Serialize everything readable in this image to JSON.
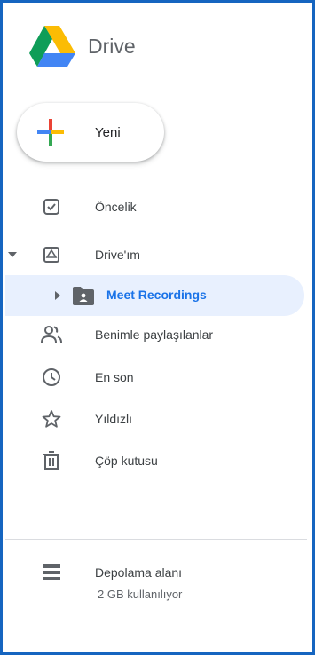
{
  "app": {
    "title": "Drive"
  },
  "new_button": {
    "label": "Yeni"
  },
  "nav": {
    "priority": "Öncelik",
    "my_drive": "Drive'ım",
    "meet_recordings": "Meet Recordings",
    "shared": "Benimle paylaşılanlar",
    "recent": "En son",
    "starred": "Yıldızlı",
    "trash": "Çöp kutusu",
    "storage": "Depolama alanı"
  },
  "storage": {
    "used": "2 GB kullanılıyor"
  },
  "colors": {
    "accent_blue": "#1a73e8",
    "selected_bg": "#e8f0fe",
    "frame_border": "#1565c0",
    "icon_gray": "#5f6368",
    "text": "#3c4043"
  },
  "icons": {
    "priority": "check-box-icon",
    "my_drive": "drive-icon",
    "meet_recordings": "shared-folder-icon",
    "shared": "people-icon",
    "recent": "clock-icon",
    "starred": "star-icon",
    "trash": "trash-icon",
    "storage": "storage-icon"
  }
}
